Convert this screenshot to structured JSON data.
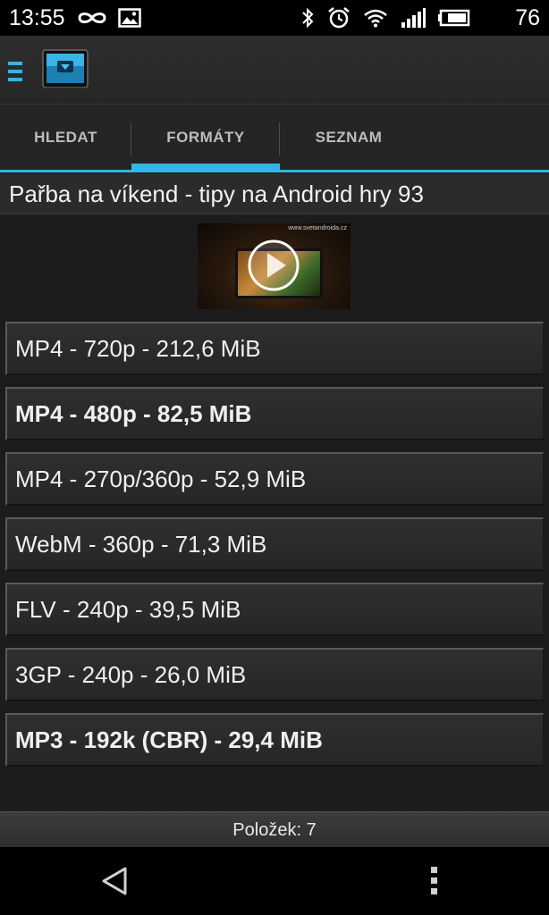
{
  "status_bar": {
    "time": "13:55",
    "battery_level": "76",
    "icons_left": [
      "infinity-icon",
      "image-icon"
    ],
    "icons_right": [
      "bluetooth-icon",
      "alarm-icon",
      "wifi-icon",
      "signal-icon",
      "battery-icon"
    ]
  },
  "action_bar": {
    "menu_icon": "hamburger-menu-icon",
    "logo_icon": "tv-logo-icon",
    "accent_color": "#33b5e5"
  },
  "tabs": [
    {
      "label": "HLEDAT",
      "selected": false
    },
    {
      "label": "FORMÁTY",
      "selected": true
    },
    {
      "label": "SEZNAM",
      "selected": false
    }
  ],
  "video": {
    "title": "Pařba na víkend - tipy na Android hry 93",
    "thumbnail_watermark": "www.svetandroida.cz"
  },
  "formats": [
    {
      "label": "MP4 - 720p - 212,6 MiB",
      "bold": false
    },
    {
      "label": "MP4 - 480p - 82,5 MiB",
      "bold": true
    },
    {
      "label": "MP4 - 270p/360p - 52,9 MiB",
      "bold": false
    },
    {
      "label": "WebM - 360p - 71,3 MiB",
      "bold": false
    },
    {
      "label": "FLV - 240p - 39,5 MiB",
      "bold": false
    },
    {
      "label": "3GP - 240p - 26,0 MiB",
      "bold": false
    },
    {
      "label": "MP3 - 192k (CBR) - 29,4 MiB",
      "bold": true
    }
  ],
  "footer": {
    "item_count": "Položek: 7"
  },
  "nav_bar": {
    "back_icon": "back-triangle-icon",
    "overflow_icon": "overflow-menu-icon"
  }
}
